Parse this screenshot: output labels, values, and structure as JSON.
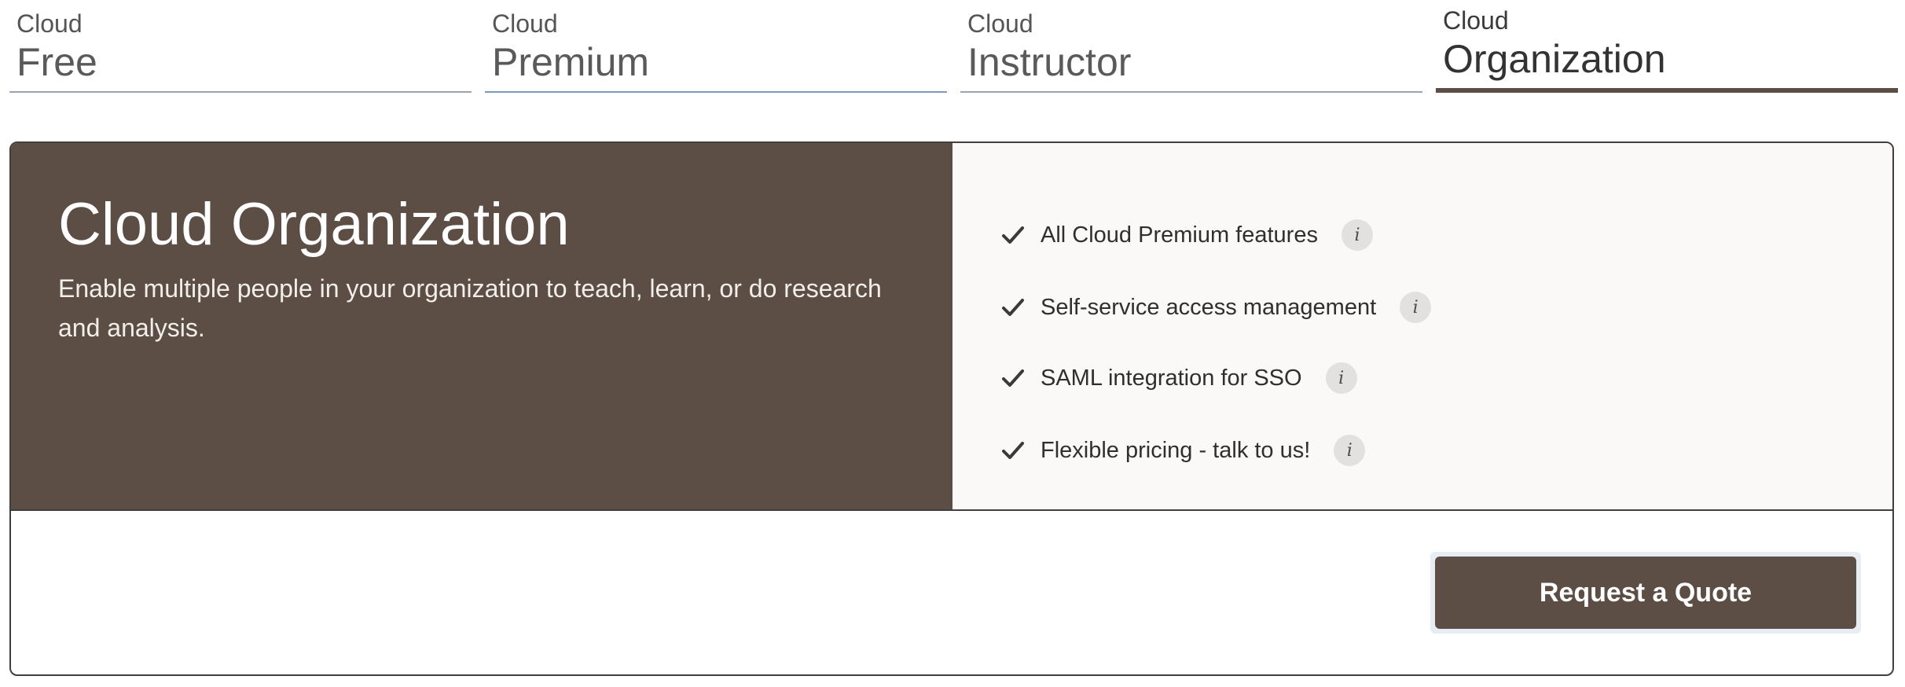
{
  "tabs": [
    {
      "small": "Cloud",
      "big": "Free"
    },
    {
      "small": "Cloud",
      "big": "Premium"
    },
    {
      "small": "Cloud",
      "big": "Instructor"
    },
    {
      "small": "Cloud",
      "big": "Organization"
    }
  ],
  "active_tab": "Organization",
  "plan": {
    "title": "Cloud Organization",
    "description": "Enable multiple people in your organization to teach, learn, or do research and analysis."
  },
  "features": [
    {
      "text": "All Cloud Premium features",
      "icon": "check-icon",
      "info_icon": "info-icon",
      "info_glyph": "i"
    },
    {
      "text": "Self-service access management",
      "icon": "check-icon",
      "info_icon": "info-icon",
      "info_glyph": "i"
    },
    {
      "text": "SAML integration for SSO",
      "icon": "check-icon",
      "info_icon": "info-icon",
      "info_glyph": "i"
    },
    {
      "text": "Flexible pricing - talk to us!",
      "icon": "check-icon",
      "info_icon": "info-icon",
      "info_glyph": "i"
    }
  ],
  "cta": {
    "label": "Request a Quote"
  },
  "colors": {
    "brand_brown": "#5c4e45",
    "panel_bg": "#faf9f7",
    "tab_underline": "#9aa3b2",
    "tab_underline_premium": "#7e97bf"
  }
}
